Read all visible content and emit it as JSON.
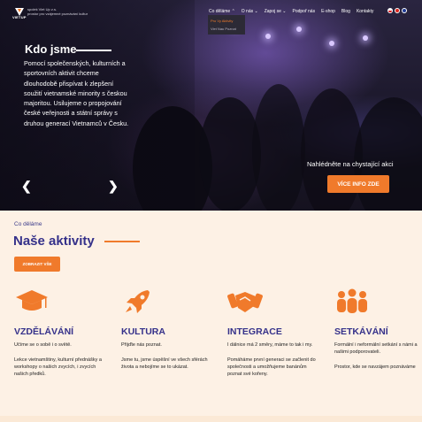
{
  "header": {
    "logo_text": "VIETUP",
    "org_line1": "spolek Viet Up z.s.",
    "org_line2": "prostor pro vzájemné poznávání kultur",
    "nav": [
      "Co děláme",
      "O nás",
      "Zapoj se",
      "Podpoř nás",
      "E-shop",
      "Blog",
      "Kontakty"
    ],
    "dropdown": [
      "Pro Vy Aktivity",
      "Viet Nau Poznat"
    ],
    "languages": [
      "cz",
      "vn",
      "en"
    ]
  },
  "hero": {
    "title": "Kdo jsme",
    "text": "Pomocí společenských, kulturních a sportovních aktivit chceme dlouhodobě přispívat k zlepšení soužití vietnamské minority s českou majoritou. Usilujeme o propojování české veřejnosti a státní správy s druhou generací Vietnamců v Česku.",
    "event_text": "Nahlédněte na chystající akci",
    "more_button": "VÍCE INFO ZDE",
    "prev_arrow": "❮",
    "next_arrow": "❯"
  },
  "activities": {
    "kicker": "Co děláme",
    "title": "Naše aktivity",
    "show_all": "ZOBRAZIT VŠE",
    "items": [
      {
        "icon": "graduation-cap-icon",
        "title": "VZDĚLÁVÁNÍ",
        "p1": "Učíme se o sobě i o světě.",
        "p2": "Lekce vietnamštiny, kulturní přednášky a workshopy o našich zvycích, i zvycích našich předků."
      },
      {
        "icon": "rocket-icon",
        "title": "KULTURA",
        "p1": "Přijďte nás poznat.",
        "p2": "Jsme tu, jsme úspěšní ve všech sférách života a nebojíme se to ukázat."
      },
      {
        "icon": "handshake-icon",
        "title": "INTEGRACE",
        "p1": "I dálnice má 2 směry, máme to tak i my.",
        "p2": "Pomáháme první generaci se začlenit do společnosti a umožňujeme banánům poznat své kořeny."
      },
      {
        "icon": "people-group-icon",
        "title": "SETKÁVÁNÍ",
        "p1": "Formální i neformální setkání s námi a našimi podporovateli.",
        "p2": "Prostor, kde se navzájem poznáváme"
      }
    ]
  },
  "colors": {
    "accent": "#f07a2b",
    "primary": "#35318a",
    "background": "#fdf1e5"
  }
}
